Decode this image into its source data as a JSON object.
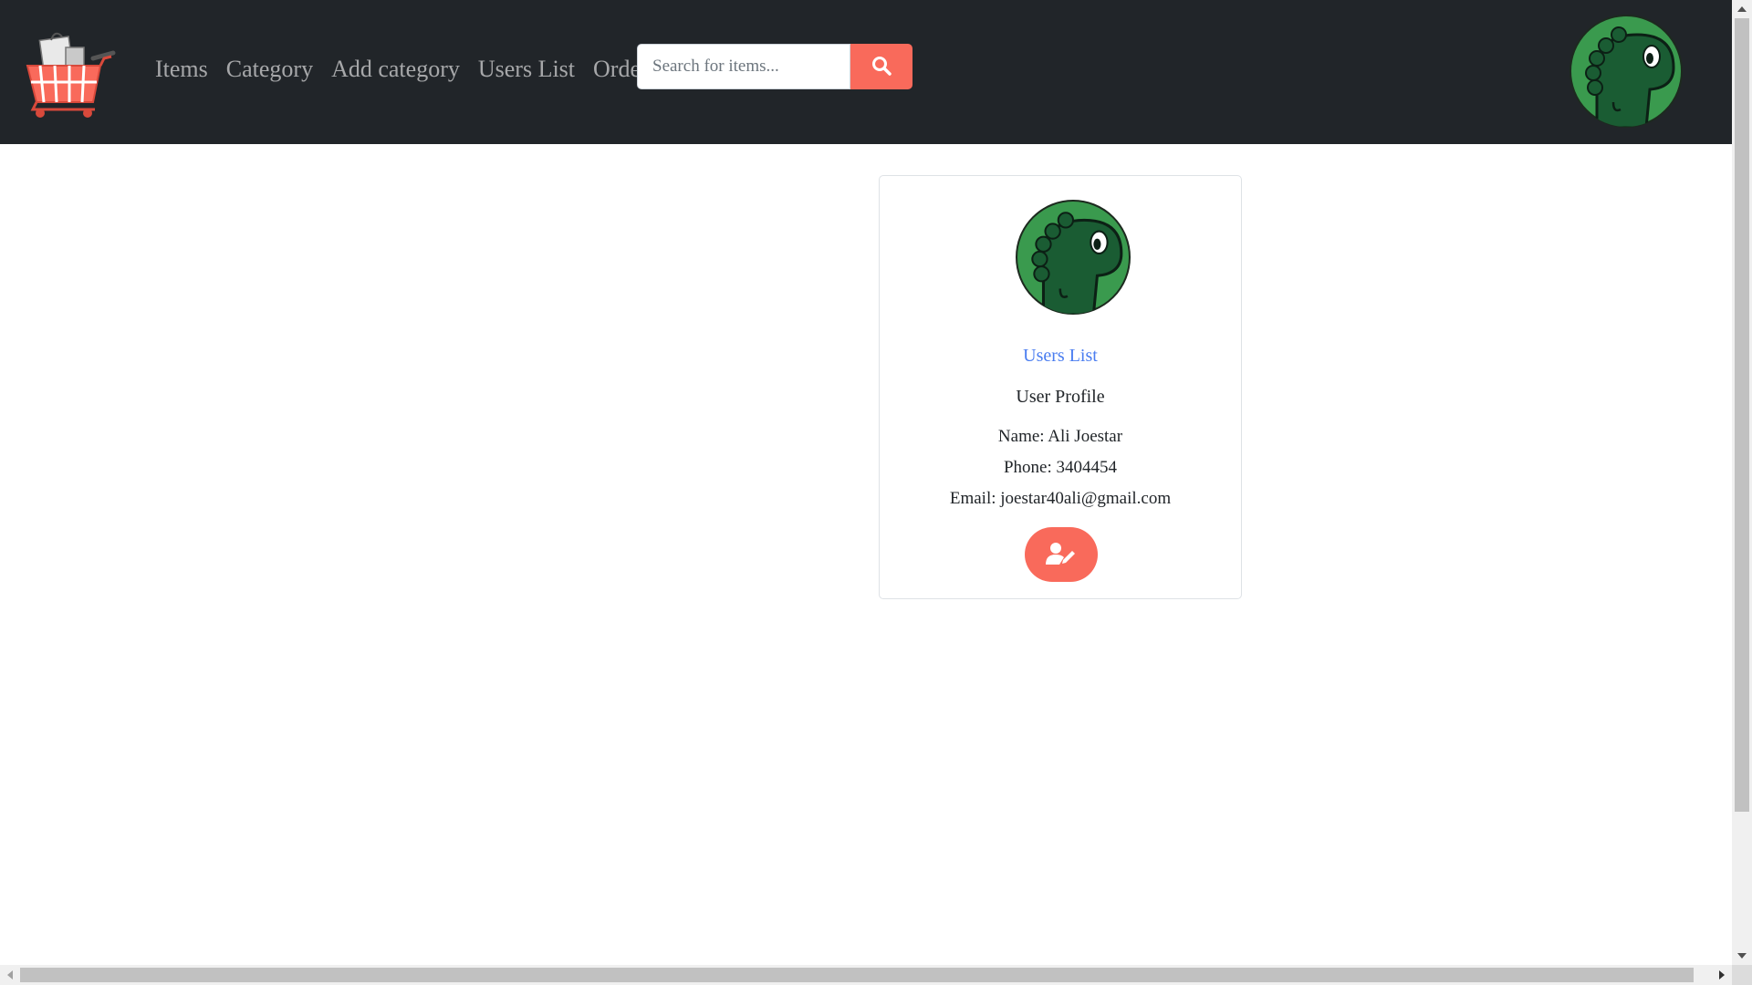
{
  "navbar": {
    "logo_icon": "shopping-cart-logo",
    "links": [
      {
        "label": "Items"
      },
      {
        "label": "Category"
      },
      {
        "label": "Add category"
      },
      {
        "label": "Users List"
      },
      {
        "label": "Orders"
      }
    ],
    "search": {
      "placeholder": "Search for items...",
      "value": "",
      "button_icon": "search-icon"
    },
    "avatar_icon": "dinosaur-avatar"
  },
  "profile_card": {
    "avatar_icon": "dinosaur-avatar",
    "users_link": "Users List",
    "title": "User Profile",
    "name_line": "Name: Ali Joestar",
    "phone_line": "Phone: 3404454",
    "email_line": "Email: joestar40ali@gmail.com",
    "edit_button_icon": "user-edit-icon"
  },
  "colors": {
    "navbar_bg": "#212529",
    "accent": "#f96a5b",
    "link": "#4a7df0",
    "avatar_green": "#3a9a4e",
    "dino_green": "#1a5c33"
  }
}
